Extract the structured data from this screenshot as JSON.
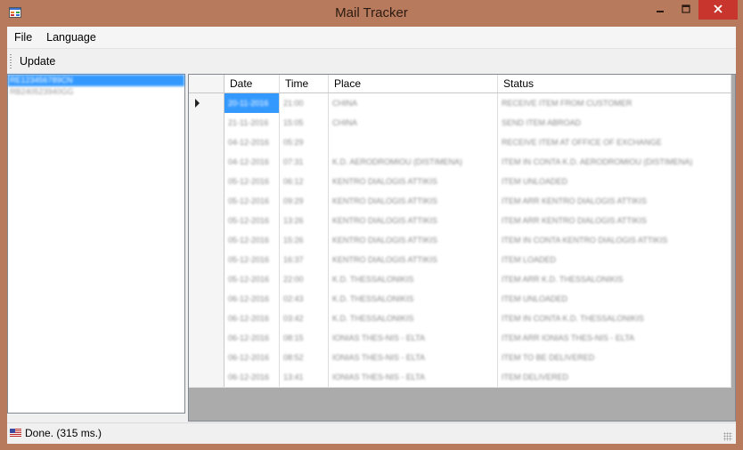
{
  "window": {
    "title": "Mail Tracker"
  },
  "menu": {
    "file": "File",
    "language": "Language"
  },
  "toolbar": {
    "update": "Update"
  },
  "tracking_list": {
    "items": [
      "RE123456789CN",
      "RB240523940GG"
    ],
    "selected_index": 0
  },
  "grid": {
    "columns": [
      "Date",
      "Time",
      "Place",
      "Status"
    ],
    "rows": [
      [
        "20-11-2016",
        "21:00",
        "CHINA",
        "RECEIVE ITEM FROM CUSTOMER"
      ],
      [
        "21-11-2016",
        "15:05",
        "CHINA",
        "SEND ITEM ABROAD"
      ],
      [
        "04-12-2016",
        "05:29",
        "",
        "RECEIVE ITEM AT OFFICE OF EXCHANGE"
      ],
      [
        "04-12-2016",
        "07:31",
        "K.D. AERODROMIOU (DISTIMENA)",
        "ITEM IN CONTA K.D. AERODROMIOU (DISTIMENA)"
      ],
      [
        "05-12-2016",
        "06:12",
        "KENTRO DIALOGIS ATTIKIS",
        "ITEM UNLOADED"
      ],
      [
        "05-12-2016",
        "09:29",
        "KENTRO DIALOGIS ATTIKIS",
        "ITEM ARR KENTRO DIALOGIS ATTIKIS"
      ],
      [
        "05-12-2016",
        "13:26",
        "KENTRO DIALOGIS ATTIKIS",
        "ITEM ARR KENTRO DIALOGIS ATTIKIS"
      ],
      [
        "05-12-2016",
        "15:26",
        "KENTRO DIALOGIS ATTIKIS",
        "ITEM IN CONTA KENTRO DIALOGIS ATTIKIS"
      ],
      [
        "05-12-2016",
        "16:37",
        "KENTRO DIALOGIS ATTIKIS",
        "ITEM LOADED"
      ],
      [
        "05-12-2016",
        "22:00",
        "K.D. THESSALONIKIS",
        "ITEM ARR K.D. THESSALONIKIS"
      ],
      [
        "06-12-2016",
        "02:43",
        "K.D. THESSALONIKIS",
        "ITEM UNLOADED"
      ],
      [
        "06-12-2016",
        "03:42",
        "K.D. THESSALONIKIS",
        "ITEM IN CONTA K.D. THESSALONIKIS"
      ],
      [
        "06-12-2016",
        "08:15",
        "IONIAS THES-NIS - ELTA",
        "ITEM ARR IONIAS THES-NIS - ELTA"
      ],
      [
        "06-12-2016",
        "08:52",
        "IONIAS THES-NIS - ELTA",
        "ITEM TO BE DELIVERED"
      ],
      [
        "06-12-2016",
        "13:41",
        "IONIAS THES-NIS - ELTA",
        "ITEM DELIVERED"
      ]
    ]
  },
  "status": {
    "text": "Done. (315 ms.)"
  },
  "icons": {
    "app": "app-window-icon",
    "minimize": "minimize-icon",
    "maximize": "maximize-icon",
    "close": "close-icon",
    "flag": "us-flag-icon"
  },
  "colors": {
    "frame": "#b87a5c",
    "close_button": "#c7352c",
    "selection": "#3399ff",
    "grid_background": "#ababab"
  }
}
